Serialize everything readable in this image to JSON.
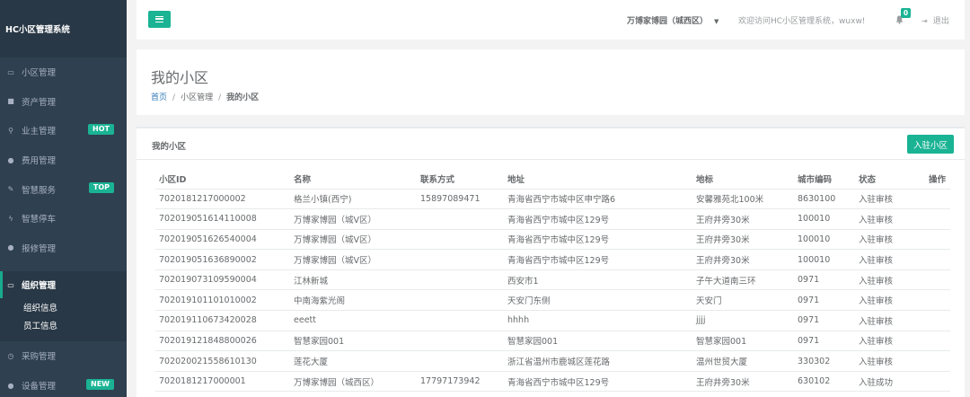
{
  "app": {
    "title": "HC小区管理系统"
  },
  "sidebar": {
    "items": [
      {
        "label": "小区管理",
        "icon": "monitor-icon",
        "glyph": "▭"
      },
      {
        "label": "资产管理",
        "icon": "grid-icon",
        "glyph": "■"
      },
      {
        "label": "业主管理",
        "icon": "user-icon",
        "glyph": "⚲",
        "badge": "HOT"
      },
      {
        "label": "费用管理",
        "icon": "globe-icon",
        "glyph": "●"
      },
      {
        "label": "智慧服务",
        "icon": "edit-icon",
        "glyph": "✎",
        "badge": "TOP"
      },
      {
        "label": "智慧停车",
        "icon": "flash-icon",
        "glyph": "ϟ"
      },
      {
        "label": "报修管理",
        "icon": "globe-icon",
        "glyph": "●"
      }
    ],
    "active": {
      "label": "组织管理",
      "icon": "desktop-icon",
      "glyph": "▭",
      "children": [
        "组织信息",
        "员工信息"
      ]
    },
    "items_after": [
      {
        "label": "采购管理",
        "icon": "clock-icon",
        "glyph": "◷"
      },
      {
        "label": "设备管理",
        "icon": "globe-icon",
        "glyph": "●",
        "badge": "NEW"
      }
    ]
  },
  "header": {
    "community": "万博家博园（城西区）",
    "welcome": "欢迎访问HC小区管理系统，wuxw!",
    "notification_count": "0",
    "logout": "退出"
  },
  "page": {
    "title": "我的小区",
    "breadcrumb": {
      "home": "首页",
      "section": "小区管理",
      "current": "我的小区"
    }
  },
  "panel": {
    "title": "我的小区",
    "add_button": "入驻小区",
    "columns": [
      "小区ID",
      "名称",
      "联系方式",
      "地址",
      "地标",
      "城市编码",
      "状态",
      "操作"
    ],
    "rows": [
      [
        "7020181217000002",
        "格兰小镇(西宁)",
        "15897089471",
        "青海省西宁市城中区申宁路6",
        "安馨雅苑北100米",
        "8630100",
        "入驻审核",
        ""
      ],
      [
        "702019051614110008",
        "万博家博园（城V区）",
        "",
        "青海省西宁市城中区129号",
        "王府井旁30米",
        "100010",
        "入驻审核",
        ""
      ],
      [
        "702019051626540004",
        "万博家博园（城V区）",
        "",
        "青海省西宁市城中区129号",
        "王府井旁30米",
        "100010",
        "入驻审核",
        ""
      ],
      [
        "702019051636890002",
        "万博家博园（城V区）",
        "",
        "青海省西宁市城中区129号",
        "王府井旁30米",
        "100010",
        "入驻审核",
        ""
      ],
      [
        "702019073109590004",
        "江林新城",
        "",
        "西安市1",
        "子午大道南三环",
        "0971",
        "入驻审核",
        ""
      ],
      [
        "702019101101010002",
        "中南海紫光阁",
        "",
        "天安门东侧",
        "天安门",
        "0971",
        "入驻审核",
        ""
      ],
      [
        "702019110673420028",
        "eeett",
        "",
        "hhhh",
        "jjjj",
        "0971",
        "入驻审核",
        ""
      ],
      [
        "702019121848800026",
        "智慧家园001",
        "",
        "智慧家园001",
        "智慧家园001",
        "0971",
        "入驻审核",
        ""
      ],
      [
        "702020021558610130",
        "莲花大厦",
        "",
        "浙江省温州市鹿城区莲花路",
        "温州世贸大厦",
        "330302",
        "入驻审核",
        ""
      ],
      [
        "7020181217000001",
        "万博家博园（城西区）",
        "17797173942",
        "青海省西宁市城中区129号",
        "王府井旁30米",
        "630102",
        "入驻成功",
        ""
      ]
    ]
  },
  "colors": {
    "accent": "#1ab394",
    "sidebar_bg": "#2f4050",
    "link": "#337ab7"
  }
}
